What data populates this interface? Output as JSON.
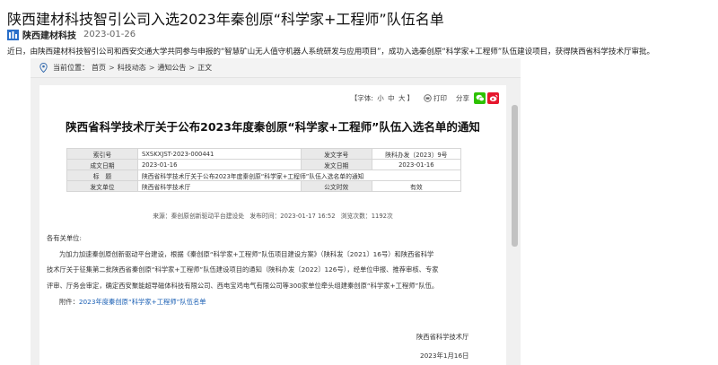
{
  "article": {
    "title": "陕西建材科技智引公司入选2023年秦创原“科学家+工程师”队伍名单",
    "author": "陕西建材科技",
    "date": "2023-01-26",
    "intro": "近日，由陕西建材科技智引公司和西安交通大学共同参与申报的“智慧矿山无人值守机器人系统研发与应用项目”，成功入选秦创原“科学家+工程师”队伍建设项目，获得陕西省科学技术厅审批。"
  },
  "screenshot": {
    "breadcrumb": {
      "prefix": "当前位置：",
      "items": [
        "首页",
        "科技动态",
        "通知公告",
        "正文"
      ],
      "separator": ">"
    },
    "toolbar": {
      "font_label": "【字体:",
      "font_small": "小",
      "font_medium": "中",
      "font_large": "大",
      "font_close": "】",
      "print": "打印",
      "share": "分享"
    },
    "notice_title": "陕西省科学技术厅关于公布2023年度秦创原“科学家+工程师”队伍入选名单的通知",
    "info_table": {
      "index_label": "索引号",
      "index_value": "SXSKXJST-2023-000441",
      "docno_label": "发文字号",
      "docno_value": "陕科办发〔2023〕9号",
      "created_label": "成文日期",
      "created_value": "2023-01-16",
      "published_label": "发文日期",
      "published_value": "2023-01-16",
      "subject_label": "标　题",
      "subject_value": "陕西省科学技术厅关于公布2023年度秦创原“科学家+工程师”队伍入选名单的通知",
      "issuer_label": "发文单位",
      "issuer_value": "陕西省科学技术厅",
      "validity_label": "公文时效",
      "validity_value": "有效"
    },
    "source": {
      "from": "来源：秦创原创新驱动平台建设处",
      "time": "发布时间：2023-01-17 16:52",
      "views": "浏览次数：1192次"
    },
    "body": {
      "greeting": "各有关单位:",
      "line1": "为加力加速秦创原创新驱动平台建设，根据《秦创原“科学家+工程师”队伍项目建设方案》（陕科发〔2021〕16号）和陕西省科学",
      "line2": "技术厅关于征集第二批陕西省秦创原“科学家+工程师”队伍建设项目的通知（陕科办发〔2022〕126号），经单位申报、推荐审核、专家",
      "line3": "评审、厅务会审定，确定西安聚能超导磁体科技有限公司、西电宝鸡电气有限公司等300家单位牵头组建秦创原“科学家+工程师”队伍。",
      "attachment_label": "附件：",
      "attachment_link": "2023年度秦创原“科学家+工程师”队伍名单"
    },
    "signature": "陕西省科学技术厅",
    "signature_date": "2023年1月16日"
  },
  "colors": {
    "link": "#1a5fb4",
    "wechat": "#2dc100",
    "weibo": "#e6162d",
    "author_logo": "#2a6fc9"
  }
}
